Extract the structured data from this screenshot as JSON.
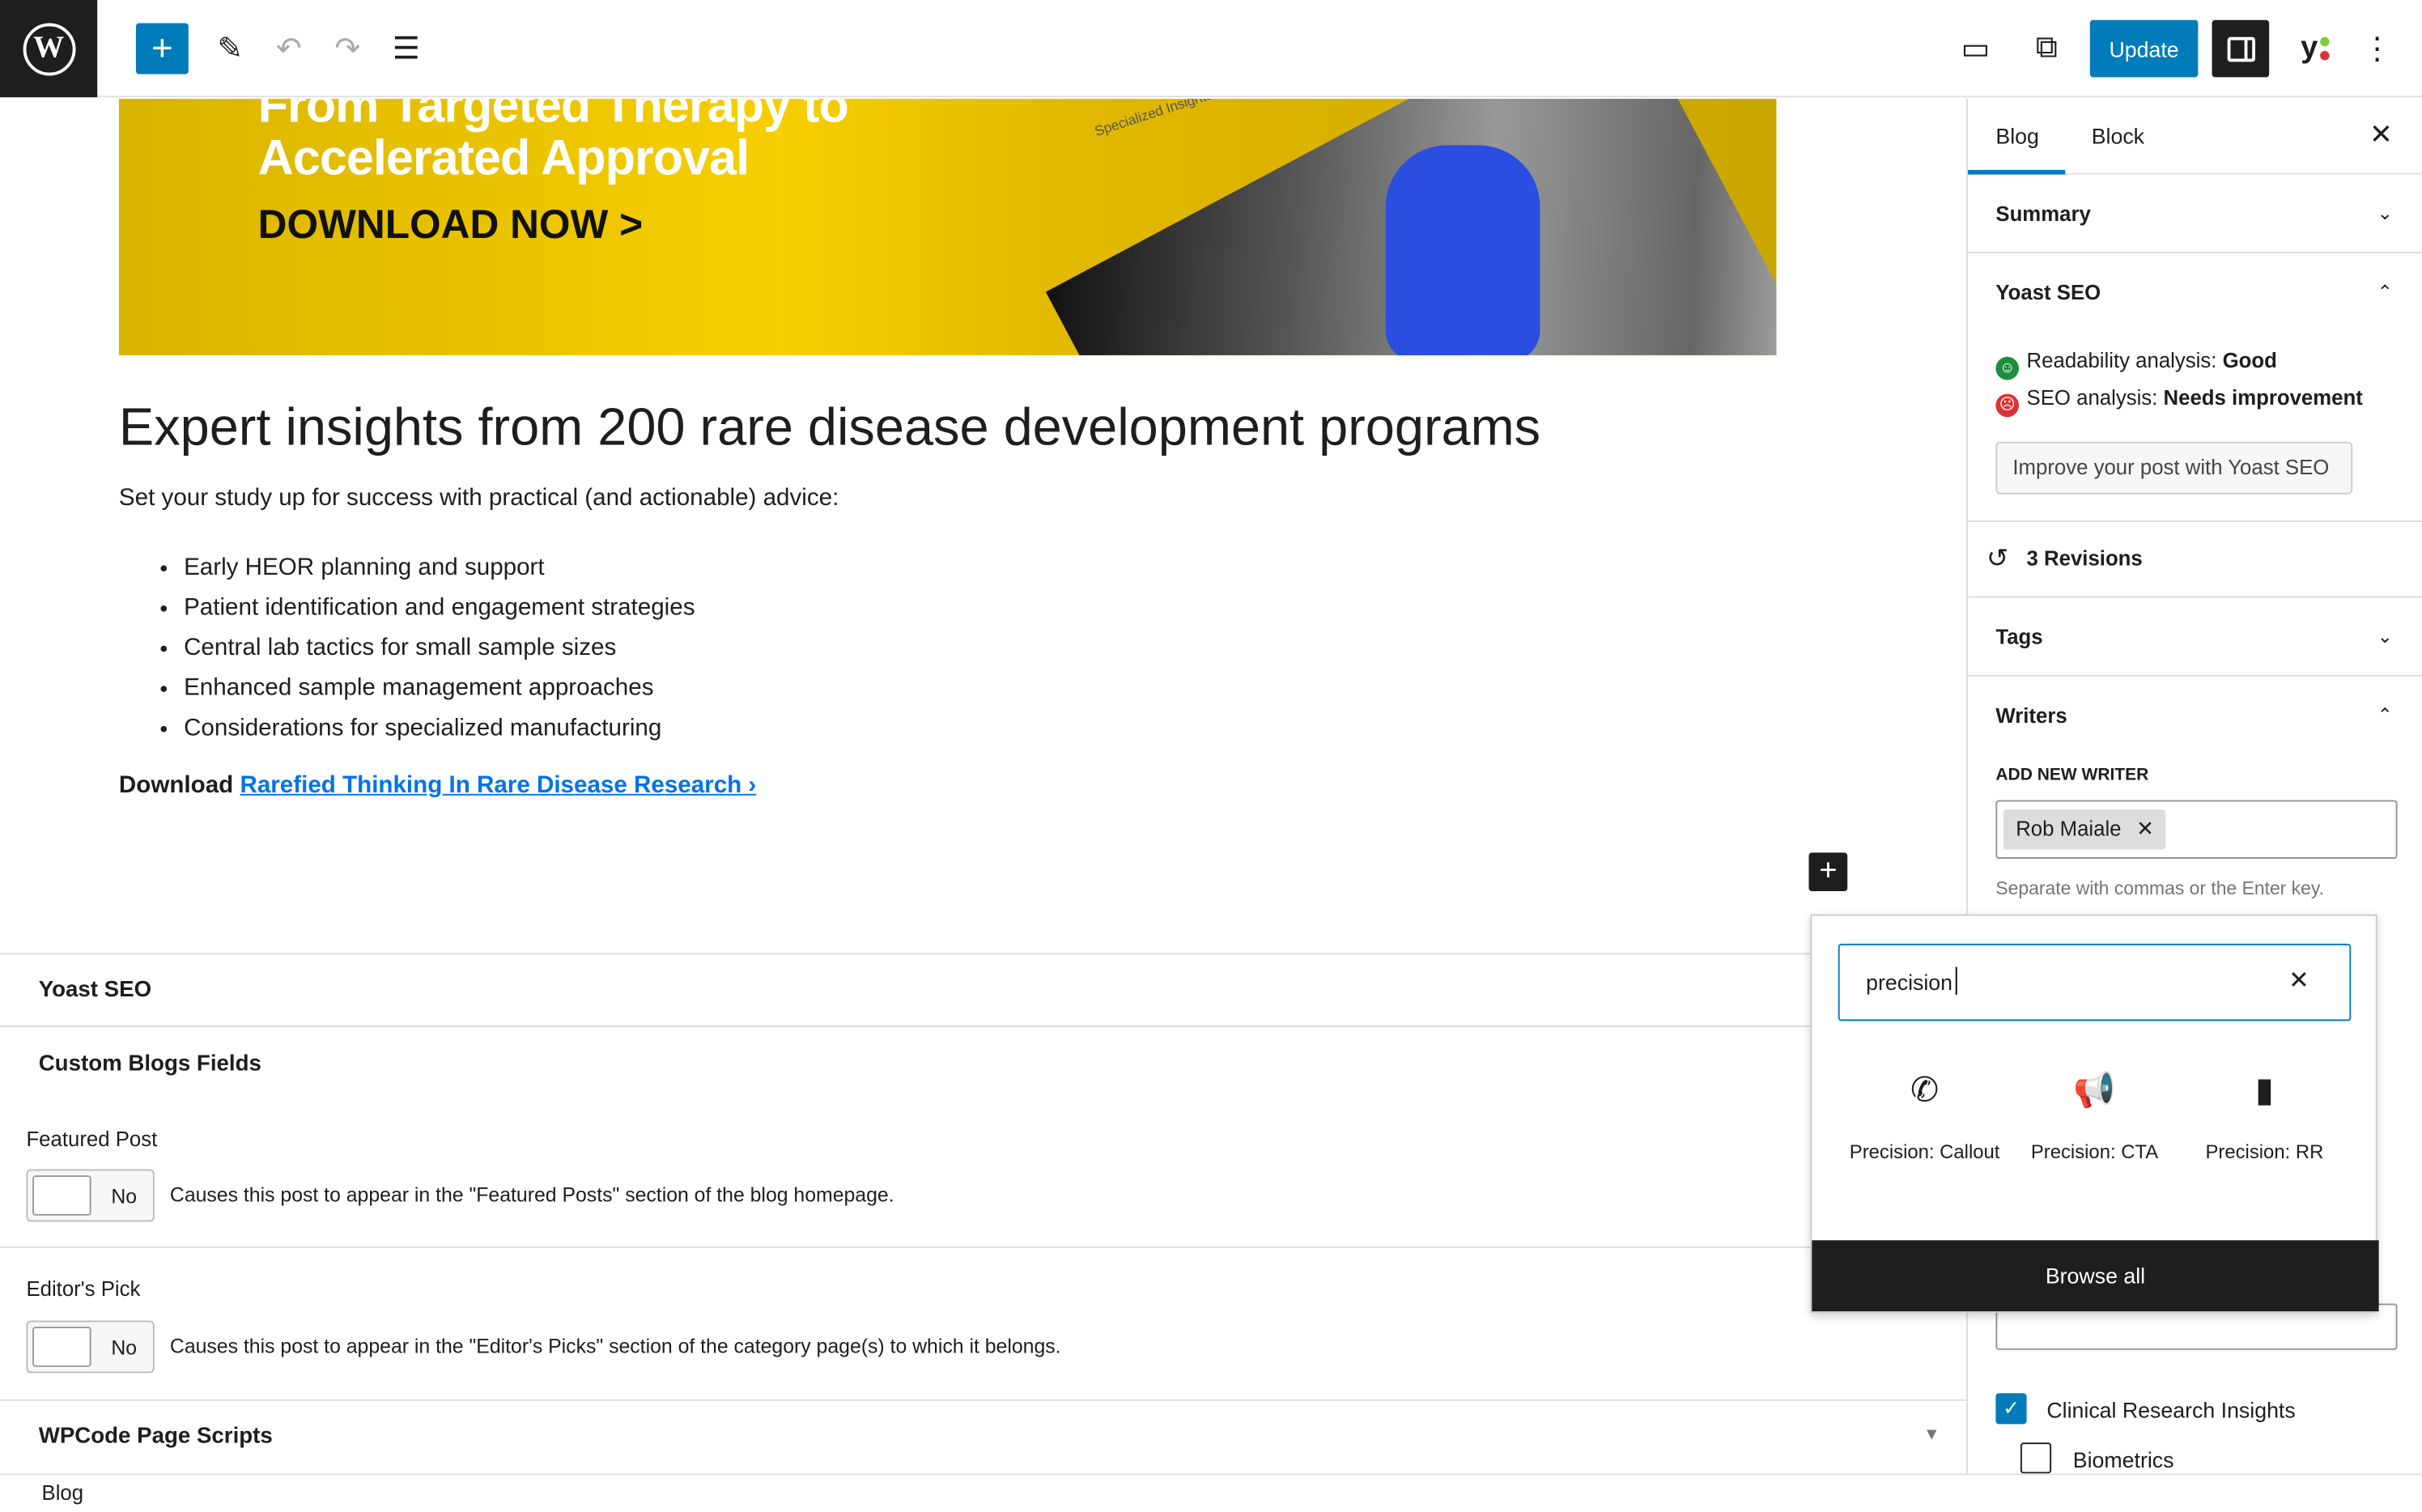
{
  "toolbar": {
    "update_label": "Update",
    "icons": [
      "wordpress-logo",
      "plus-icon",
      "pencil-icon",
      "undo-icon",
      "redo-icon",
      "list-view-icon",
      "desktop-preview-icon",
      "external-link-icon",
      "sidebar-toggle-icon",
      "yoast-icon",
      "more-vertical-icon"
    ]
  },
  "banner": {
    "line1": "From Targeted Therapy to",
    "line2": "Accelerated Approval",
    "cta": "DOWNLOAD NOW >",
    "book_text": "Specialized Insights"
  },
  "content": {
    "heading": "Expert insights from 200 rare disease development programs",
    "intro": "Set your study up for success with practical (and actionable) advice:",
    "bullets": [
      "Early HEOR planning and support",
      "Patient identification and engagement strategies",
      "Central lab tactics for small sample sizes",
      "Enhanced sample management approaches",
      "Considerations for specialized manufacturing"
    ],
    "download_prefix": "Download",
    "download_link": "Rarefied Thinking In Rare Disease Research ›"
  },
  "meta": {
    "yoast": "Yoast SEO",
    "custom": "Custom Blogs Fields",
    "featured_label": "Featured Post",
    "featured_value": "No",
    "featured_desc": "Causes this post to appear in the \"Featured Posts\" section of the blog homepage.",
    "editors_label": "Editor's Pick",
    "editors_value": "No",
    "editors_desc": "Causes this post to appear in the \"Editor's Picks\" section of the category page(s) to which it belongs.",
    "wpcode": "WPCode Page Scripts"
  },
  "footer": {
    "breadcrumb": "Blog"
  },
  "sidebar": {
    "tabs": [
      "Blog",
      "Block"
    ],
    "summary": "Summary",
    "yoast": "Yoast SEO",
    "readability_prefix": "Readability analysis:",
    "readability_value": "Good",
    "seo_prefix": "SEO analysis:",
    "seo_value": "Needs improvement",
    "improve_button": "Improve your post with Yoast SEO",
    "revisions": "3 Revisions",
    "tags": "Tags",
    "writers": "Writers",
    "add_writer": "ADD NEW WRITER",
    "writer_token": "Rob Maiale",
    "writer_help": "Separate with commas or the Enter key.",
    "categories": [
      {
        "label": "Clinical Research Insights",
        "checked": true
      },
      {
        "label": "Biometrics",
        "checked": false
      }
    ],
    "colors": {
      "good": "#1e8e3e",
      "bad": "#dc3232",
      "accent": "#007cba"
    }
  },
  "inserter": {
    "search_value": "precision",
    "results": [
      {
        "label": "Precision: Callout",
        "icon": "phone-icon"
      },
      {
        "label": "Precision: CTA",
        "icon": "megaphone-icon"
      },
      {
        "label": "Precision: RR",
        "icon": "book-icon"
      }
    ],
    "browse_all": "Browse all"
  }
}
